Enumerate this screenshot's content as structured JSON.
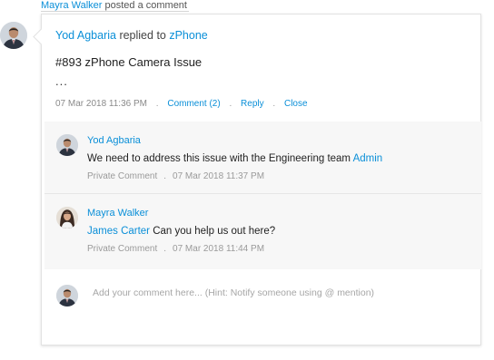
{
  "notification": {
    "actor": "Mayra Walker",
    "action": " posted a comment"
  },
  "post": {
    "author": "Yod Agbaria",
    "verb": " replied to ",
    "target": "zPhone",
    "title": "#893 zPhone Camera Issue",
    "ellipsis": "...",
    "timestamp": "07 Mar 2018 11:36 PM",
    "comment_link": "Comment (2)",
    "reply_link": "Reply",
    "close_link": "Close",
    "separator": "."
  },
  "comments": [
    {
      "author": "Yod Agbaria",
      "text": "We need to address this issue with the Engineering team ",
      "mention": "Admin",
      "visibility": "Private Comment",
      "timestamp": "07 Mar 2018 11:37 PM",
      "avatar_icon": "male-user-avatar"
    },
    {
      "author": "Mayra Walker",
      "mention": "James Carter",
      "text": " Can you help us out here?",
      "visibility": "Private Comment",
      "timestamp": "07 Mar 2018 11:44 PM",
      "avatar_icon": "female-user-avatar"
    }
  ],
  "reply": {
    "placeholder": "Add your comment here... (Hint: Notify someone using @ mention)"
  },
  "colors": {
    "link": "#0a8fd8",
    "comments_bg": "#f7f7f7",
    "muted": "#9a9a9a"
  }
}
